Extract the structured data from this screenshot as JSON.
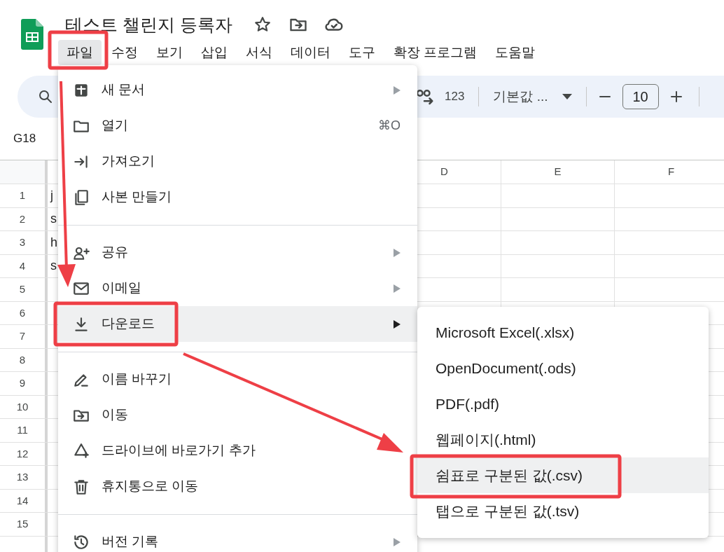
{
  "document": {
    "title": "테스트 챌린지 등록자"
  },
  "menu_bar": [
    {
      "label": "파일",
      "selected": true
    },
    {
      "label": "수정",
      "selected": false
    },
    {
      "label": "보기",
      "selected": false
    },
    {
      "label": "삽입",
      "selected": false
    },
    {
      "label": "서식",
      "selected": false
    },
    {
      "label": "데이터",
      "selected": false
    },
    {
      "label": "도구",
      "selected": false
    },
    {
      "label": "확장 프로그램",
      "selected": false
    },
    {
      "label": "도움말",
      "selected": false
    }
  ],
  "toolbar": {
    "number_format": "123",
    "font": "기본값 ...",
    "font_size": "10"
  },
  "name_box": "G18",
  "columns": [
    "D",
    "E",
    "F"
  ],
  "rows": [
    {
      "number": "1",
      "cell_a": "j"
    },
    {
      "number": "2",
      "cell_a": "s"
    },
    {
      "number": "3",
      "cell_a": "h"
    },
    {
      "number": "4",
      "cell_a": "s"
    },
    {
      "number": "5"
    },
    {
      "number": "6"
    },
    {
      "number": "7"
    },
    {
      "number": "8"
    },
    {
      "number": "9"
    },
    {
      "number": "10"
    },
    {
      "number": "11"
    },
    {
      "number": "12"
    },
    {
      "number": "13"
    },
    {
      "number": "14"
    },
    {
      "number": "15"
    }
  ],
  "file_menu": [
    {
      "kind": "item",
      "label": "새 문서",
      "submenu": true,
      "selected": false
    },
    {
      "kind": "item",
      "label": "열기",
      "shortcut": "⌘O",
      "submenu": false,
      "selected": false
    },
    {
      "kind": "item",
      "label": "가져오기",
      "submenu": false,
      "selected": false
    },
    {
      "kind": "item",
      "label": "사본 만들기",
      "submenu": false,
      "selected": false
    },
    {
      "kind": "divider"
    },
    {
      "kind": "item",
      "label": "공유",
      "submenu": true,
      "selected": false
    },
    {
      "kind": "item",
      "label": "이메일",
      "submenu": true,
      "selected": false
    },
    {
      "kind": "item",
      "label": "다운로드",
      "submenu": true,
      "selected": true
    },
    {
      "kind": "divider"
    },
    {
      "kind": "item",
      "label": "이름 바꾸기",
      "submenu": false,
      "selected": false
    },
    {
      "kind": "item",
      "label": "이동",
      "submenu": false,
      "selected": false
    },
    {
      "kind": "item",
      "label": "드라이브에 바로가기 추가",
      "submenu": false,
      "selected": false
    },
    {
      "kind": "item",
      "label": "휴지통으로 이동",
      "submenu": false,
      "selected": false
    },
    {
      "kind": "divider"
    },
    {
      "kind": "item",
      "label": "버전 기록",
      "submenu": true,
      "selected": false
    }
  ],
  "download_menu": [
    {
      "label": "Microsoft Excel(.xlsx)",
      "selected": false
    },
    {
      "label": "OpenDocument(.ods)",
      "selected": false
    },
    {
      "label": "PDF(.pdf)",
      "selected": false
    },
    {
      "label": "웹페이지(.html)",
      "selected": false
    },
    {
      "label": "쉼표로 구분된 값(.csv)",
      "selected": true
    },
    {
      "label": "탭으로 구분된 값(.tsv)",
      "selected": false
    }
  ]
}
